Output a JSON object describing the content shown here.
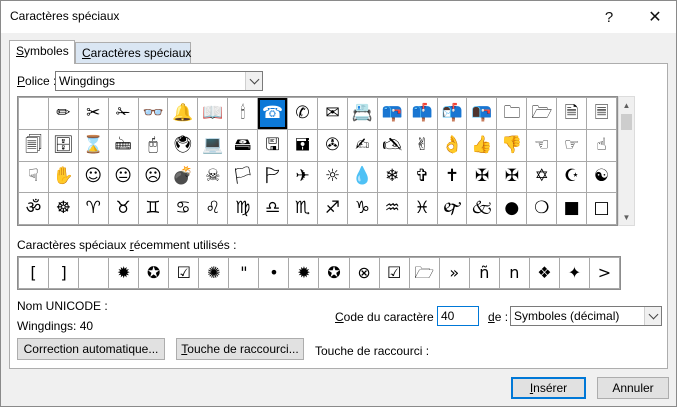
{
  "window": {
    "title": "Caractères spéciaux",
    "help_label": "?",
    "close_label": "✕"
  },
  "tabs": [
    {
      "label": "Symboles",
      "mnemonic": "S",
      "rest": "ymboles"
    },
    {
      "label": "Caractères spéciaux",
      "mnemonic": "C",
      "rest": "aractères spéciaux"
    }
  ],
  "font": {
    "label_pre": "",
    "label_mnemonic": "P",
    "label_rest": "olice :",
    "value": "Wingdings"
  },
  "symbols": [
    "",
    "✏",
    "✂",
    "✁",
    "👓",
    "🔔",
    "📖",
    "🕯",
    "☎",
    "✆",
    "✉",
    "📇",
    "📪",
    "📫",
    "📬",
    "📭",
    "🗀",
    "🗁",
    "🗎",
    "🗏",
    "🗐",
    "🗄",
    "⌛",
    "🖮",
    "🖰",
    "🖲",
    "💻",
    "🖴",
    "🖫",
    "🖬",
    "✇",
    "✍",
    "🖎",
    "✌",
    "👌",
    "👍",
    "👎",
    "☜",
    "☞",
    "☝",
    "☟",
    "✋",
    "☺",
    "😐",
    "☹",
    "💣",
    "☠",
    "🏳",
    "🏱",
    "✈",
    "☼",
    "💧",
    "❄",
    "✞",
    "✝",
    "✠",
    "✠",
    "✡",
    "☪",
    "☯",
    "ॐ",
    "☸",
    "♈",
    "♉",
    "♊",
    "♋",
    "♌",
    "♍",
    "♎",
    "♏",
    "♐",
    "♑",
    "♒",
    "♓",
    "🙰",
    "🙵",
    "●",
    "❍",
    "■",
    "□"
  ],
  "selected_index": 8,
  "recent": {
    "label_pre": "Caractères spéciaux ",
    "label_mnemonic": "r",
    "label_rest": "écemment utilisés :",
    "items": [
      "",
      "[",
      "]",
      "",
      "✹",
      "✪",
      "☑",
      "✺",
      "\"",
      "•",
      "✹",
      "✪",
      "⊗",
      "☑",
      "🗁",
      "»",
      "ñ",
      "n",
      "❖",
      "✦",
      ">"
    ]
  },
  "unicode": {
    "name_label": "Nom UNICODE :",
    "value": "Wingdings: 40"
  },
  "char_code": {
    "label_pre": "",
    "label_mnemonic": "C",
    "label_rest": "ode du caractère :",
    "value": "40"
  },
  "from": {
    "label_mnemonic": "d",
    "label_rest": "e :",
    "value": "Symboles (décimal)"
  },
  "buttons": {
    "autocorrect": {
      "label": "Correction automatique..."
    },
    "shortcut_key": {
      "pre": "",
      "mnemonic": "T",
      "rest": "ouche de raccourci..."
    },
    "insert": {
      "mnemonic": "I",
      "rest": "nsérer"
    },
    "cancel": {
      "label": "Annuler"
    }
  },
  "shortcut_label": "Touche de raccourci :",
  "colors": {
    "accent": "#0078d7",
    "selected_cell": "#0b78d7",
    "inactive_tab": "#dae6f3"
  }
}
